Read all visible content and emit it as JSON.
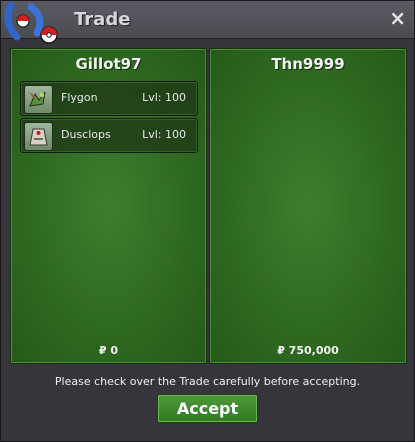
{
  "window": {
    "title": "Trade",
    "close_label": "×"
  },
  "left_trader": {
    "name": "Gillot97",
    "items": [
      {
        "name": "Flygon",
        "level": "Lvl: 100",
        "icon": "flygon-icon"
      },
      {
        "name": "Dusclops",
        "level": "Lvl: 100",
        "icon": "dusclops-icon"
      }
    ],
    "money": "₽ 0"
  },
  "right_trader": {
    "name": "Thn9999",
    "items": [],
    "money": "₽ 750,000"
  },
  "footer": {
    "notice": "Please check over the Trade carefully before accepting.",
    "accept_label": "Accept"
  },
  "colors": {
    "panel_green": "#2f6a21",
    "titlebar": "#4a4a51",
    "accept_green": "#3f8a2e"
  }
}
